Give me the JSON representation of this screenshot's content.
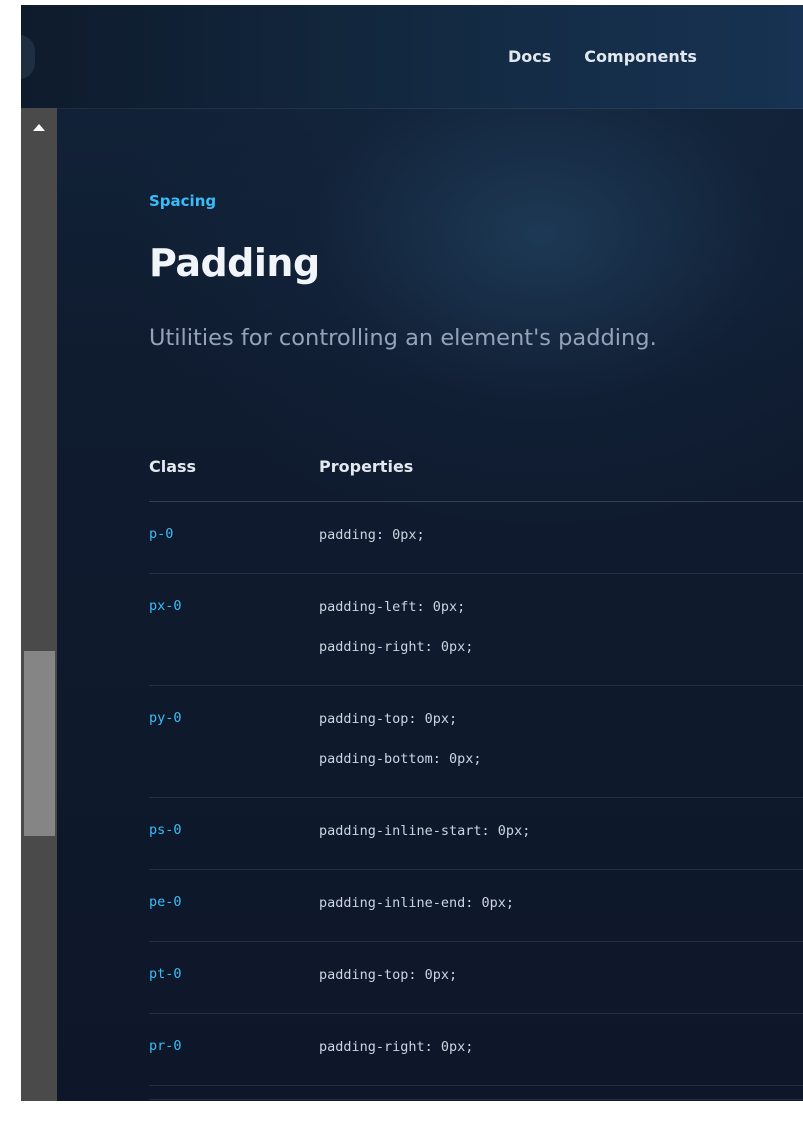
{
  "nav": {
    "docs_label": "Docs",
    "components_label": "Components"
  },
  "header": {
    "eyebrow": "Spacing",
    "title": "Padding",
    "subtitle": "Utilities for controlling an element's padding."
  },
  "table": {
    "headers": {
      "class": "Class",
      "properties": "Properties"
    },
    "rows": [
      {
        "class": "p-0",
        "props": [
          "padding: 0px;"
        ]
      },
      {
        "class": "px-0",
        "props": [
          "padding-left: 0px;",
          "padding-right: 0px;"
        ]
      },
      {
        "class": "py-0",
        "props": [
          "padding-top: 0px;",
          "padding-bottom: 0px;"
        ]
      },
      {
        "class": "ps-0",
        "props": [
          "padding-inline-start: 0px;"
        ]
      },
      {
        "class": "pe-0",
        "props": [
          "padding-inline-end: 0px;"
        ]
      },
      {
        "class": "pt-0",
        "props": [
          "padding-top: 0px;"
        ]
      },
      {
        "class": "pr-0",
        "props": [
          "padding-right: 0px;"
        ]
      }
    ]
  },
  "colors": {
    "accent": "#38bdf8",
    "background": "#0f172a",
    "scrollbar_track": "#4a4a4a",
    "scrollbar_thumb": "#858585"
  },
  "scroll": {
    "thumb_position_fraction": 0.55
  },
  "icons": {
    "scroll_up": "triangle-up-icon"
  }
}
